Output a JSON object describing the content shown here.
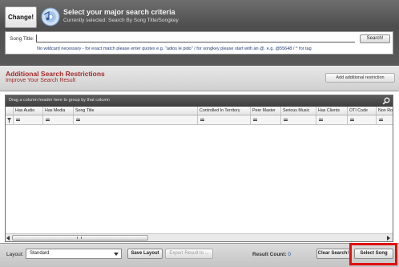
{
  "header": {
    "change_label": "Change!",
    "criteria_title": "Select your major search criteria",
    "criteria_subtitle": "Currently selected: Search By Song Title/Songkey"
  },
  "search": {
    "song_title_label": "Song Title:",
    "song_title_value": "",
    "search_button": "Search!",
    "hint": "No wildcard necessary - for exact match please enter quotes e.g. \"adios le pido\" / for songkey please start with an @. e.g. @55648 / ^ for tag"
  },
  "restrictions": {
    "title": "Additional Search Restrictions",
    "subtitle": "Improve Your Search Result",
    "add_button": "Add additional restriction"
  },
  "grid": {
    "group_hint": "Drag a column header here to group by that column",
    "columns": [
      "Has Audio",
      "Has Media",
      "Song Title",
      "Controlled In Territory",
      "Peer Master",
      "Serious Music",
      "Has Clients",
      "OTI Code",
      "Non Ro"
    ],
    "rows": []
  },
  "footer": {
    "layout_label": "Layout:",
    "layout_value": "Standard",
    "save_layout": "Save Layout",
    "export": "Export Result to ...",
    "result_count_label": "Result Count:",
    "result_count_value": "0",
    "clear_search": "Clear Search!",
    "select_song": "Select Song"
  },
  "colors": {
    "header_bg": "#5a5a5a",
    "restriction_text": "#a52a2a",
    "highlight": "#e01010"
  }
}
